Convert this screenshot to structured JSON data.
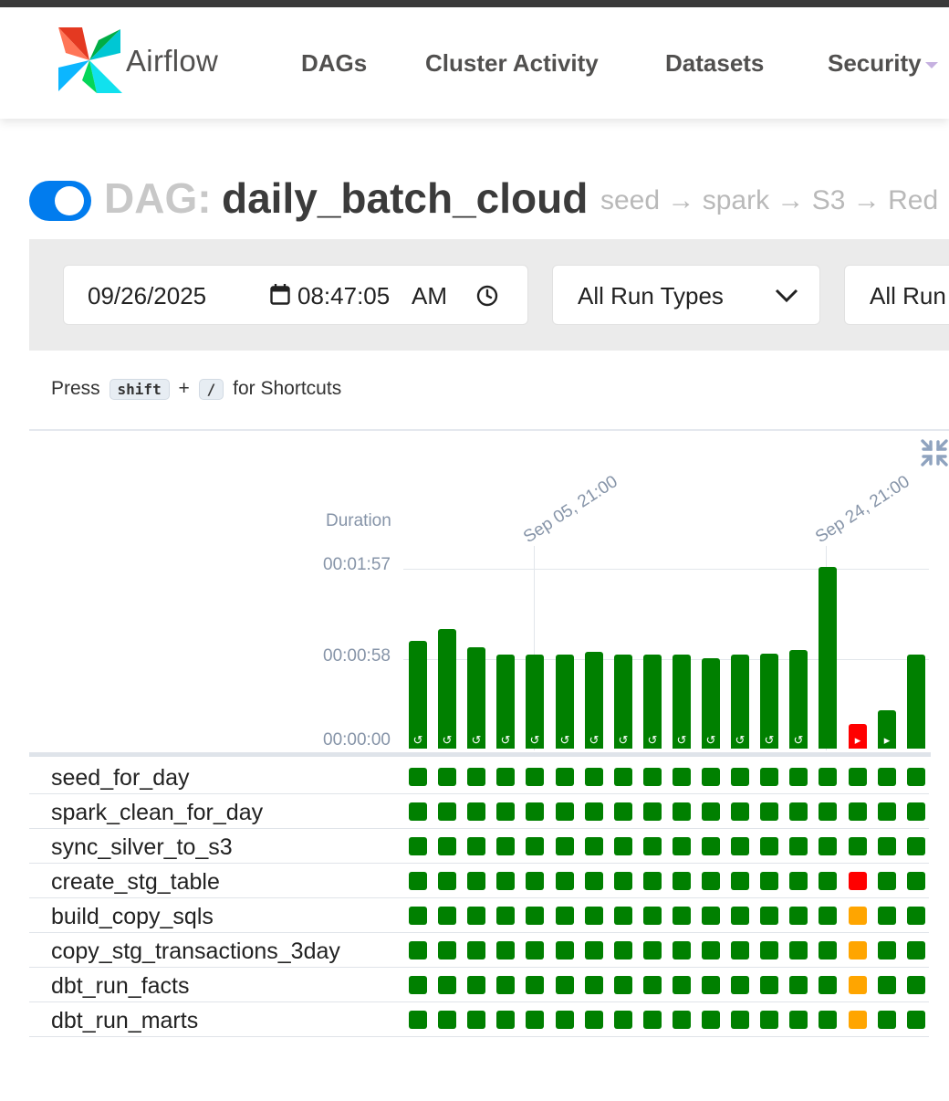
{
  "nav": {
    "brand": "Airflow",
    "items": [
      "DAGs",
      "Cluster Activity",
      "Datasets",
      "Security"
    ]
  },
  "dag": {
    "prefix": "DAG:",
    "id": "daily_batch_cloud",
    "description": "seed → spark → S3 → Red",
    "paused": false
  },
  "filters": {
    "date": "09/26/2025",
    "time": "08:47:05",
    "ampm": "AM",
    "run_type": "All Run Types",
    "run_state": "All Run"
  },
  "shortcuts": {
    "press": "Press",
    "key1": "shift",
    "plus": "+",
    "key2": "/",
    "suffix": "for Shortcuts"
  },
  "chart": {
    "y_title": "Duration",
    "y_ticks": [
      "00:01:57",
      "00:00:58",
      "00:00:00"
    ],
    "date_labels": [
      "Sep 05, 21:00",
      "Sep 24, 21:00"
    ]
  },
  "colors": {
    "success": "#008000",
    "failed": "#ff0000",
    "upstream_failed": "#ffa500",
    "accent": "#017cee"
  },
  "chart_data": {
    "type": "bar",
    "ylabel": "Duration",
    "ylim_seconds": [
      0,
      117
    ],
    "runs": [
      {
        "duration_s": 70,
        "state": "success",
        "run_type": "scheduled"
      },
      {
        "duration_s": 78,
        "state": "success",
        "run_type": "scheduled"
      },
      {
        "duration_s": 66,
        "state": "success",
        "run_type": "scheduled"
      },
      {
        "duration_s": 61,
        "state": "success",
        "run_type": "scheduled"
      },
      {
        "duration_s": 61,
        "state": "success",
        "run_type": "scheduled"
      },
      {
        "duration_s": 61,
        "state": "success",
        "run_type": "scheduled"
      },
      {
        "duration_s": 63,
        "state": "success",
        "run_type": "scheduled"
      },
      {
        "duration_s": 61,
        "state": "success",
        "run_type": "scheduled"
      },
      {
        "duration_s": 61,
        "state": "success",
        "run_type": "scheduled"
      },
      {
        "duration_s": 61,
        "state": "success",
        "run_type": "scheduled"
      },
      {
        "duration_s": 59,
        "state": "success",
        "run_type": "scheduled"
      },
      {
        "duration_s": 61,
        "state": "success",
        "run_type": "scheduled"
      },
      {
        "duration_s": 62,
        "state": "success",
        "run_type": "scheduled"
      },
      {
        "duration_s": 64,
        "state": "success",
        "run_type": "scheduled"
      },
      {
        "duration_s": 118,
        "state": "success",
        "run_type": "none"
      },
      {
        "duration_s": 16,
        "state": "failed",
        "run_type": "manual"
      },
      {
        "duration_s": 25,
        "state": "success",
        "run_type": "manual"
      },
      {
        "duration_s": 61,
        "state": "success",
        "run_type": "none"
      }
    ]
  },
  "tasks": [
    {
      "name": "seed_for_day",
      "states": [
        "success",
        "success",
        "success",
        "success",
        "success",
        "success",
        "success",
        "success",
        "success",
        "success",
        "success",
        "success",
        "success",
        "success",
        "success",
        "success",
        "success",
        "success"
      ]
    },
    {
      "name": "spark_clean_for_day",
      "states": [
        "success",
        "success",
        "success",
        "success",
        "success",
        "success",
        "success",
        "success",
        "success",
        "success",
        "success",
        "success",
        "success",
        "success",
        "success",
        "success",
        "success",
        "success"
      ]
    },
    {
      "name": "sync_silver_to_s3",
      "states": [
        "success",
        "success",
        "success",
        "success",
        "success",
        "success",
        "success",
        "success",
        "success",
        "success",
        "success",
        "success",
        "success",
        "success",
        "success",
        "success",
        "success",
        "success"
      ]
    },
    {
      "name": "create_stg_table",
      "states": [
        "success",
        "success",
        "success",
        "success",
        "success",
        "success",
        "success",
        "success",
        "success",
        "success",
        "success",
        "success",
        "success",
        "success",
        "success",
        "failed",
        "success",
        "success"
      ]
    },
    {
      "name": "build_copy_sqls",
      "states": [
        "success",
        "success",
        "success",
        "success",
        "success",
        "success",
        "success",
        "success",
        "success",
        "success",
        "success",
        "success",
        "success",
        "success",
        "success",
        "upstream_failed",
        "success",
        "success"
      ]
    },
    {
      "name": "copy_stg_transactions_3day",
      "states": [
        "success",
        "success",
        "success",
        "success",
        "success",
        "success",
        "success",
        "success",
        "success",
        "success",
        "success",
        "success",
        "success",
        "success",
        "success",
        "upstream_failed",
        "success",
        "success"
      ]
    },
    {
      "name": "dbt_run_facts",
      "states": [
        "success",
        "success",
        "success",
        "success",
        "success",
        "success",
        "success",
        "success",
        "success",
        "success",
        "success",
        "success",
        "success",
        "success",
        "success",
        "upstream_failed",
        "success",
        "success"
      ]
    },
    {
      "name": "dbt_run_marts",
      "states": [
        "success",
        "success",
        "success",
        "success",
        "success",
        "success",
        "success",
        "success",
        "success",
        "success",
        "success",
        "success",
        "success",
        "success",
        "success",
        "upstream_failed",
        "success",
        "success"
      ]
    }
  ]
}
